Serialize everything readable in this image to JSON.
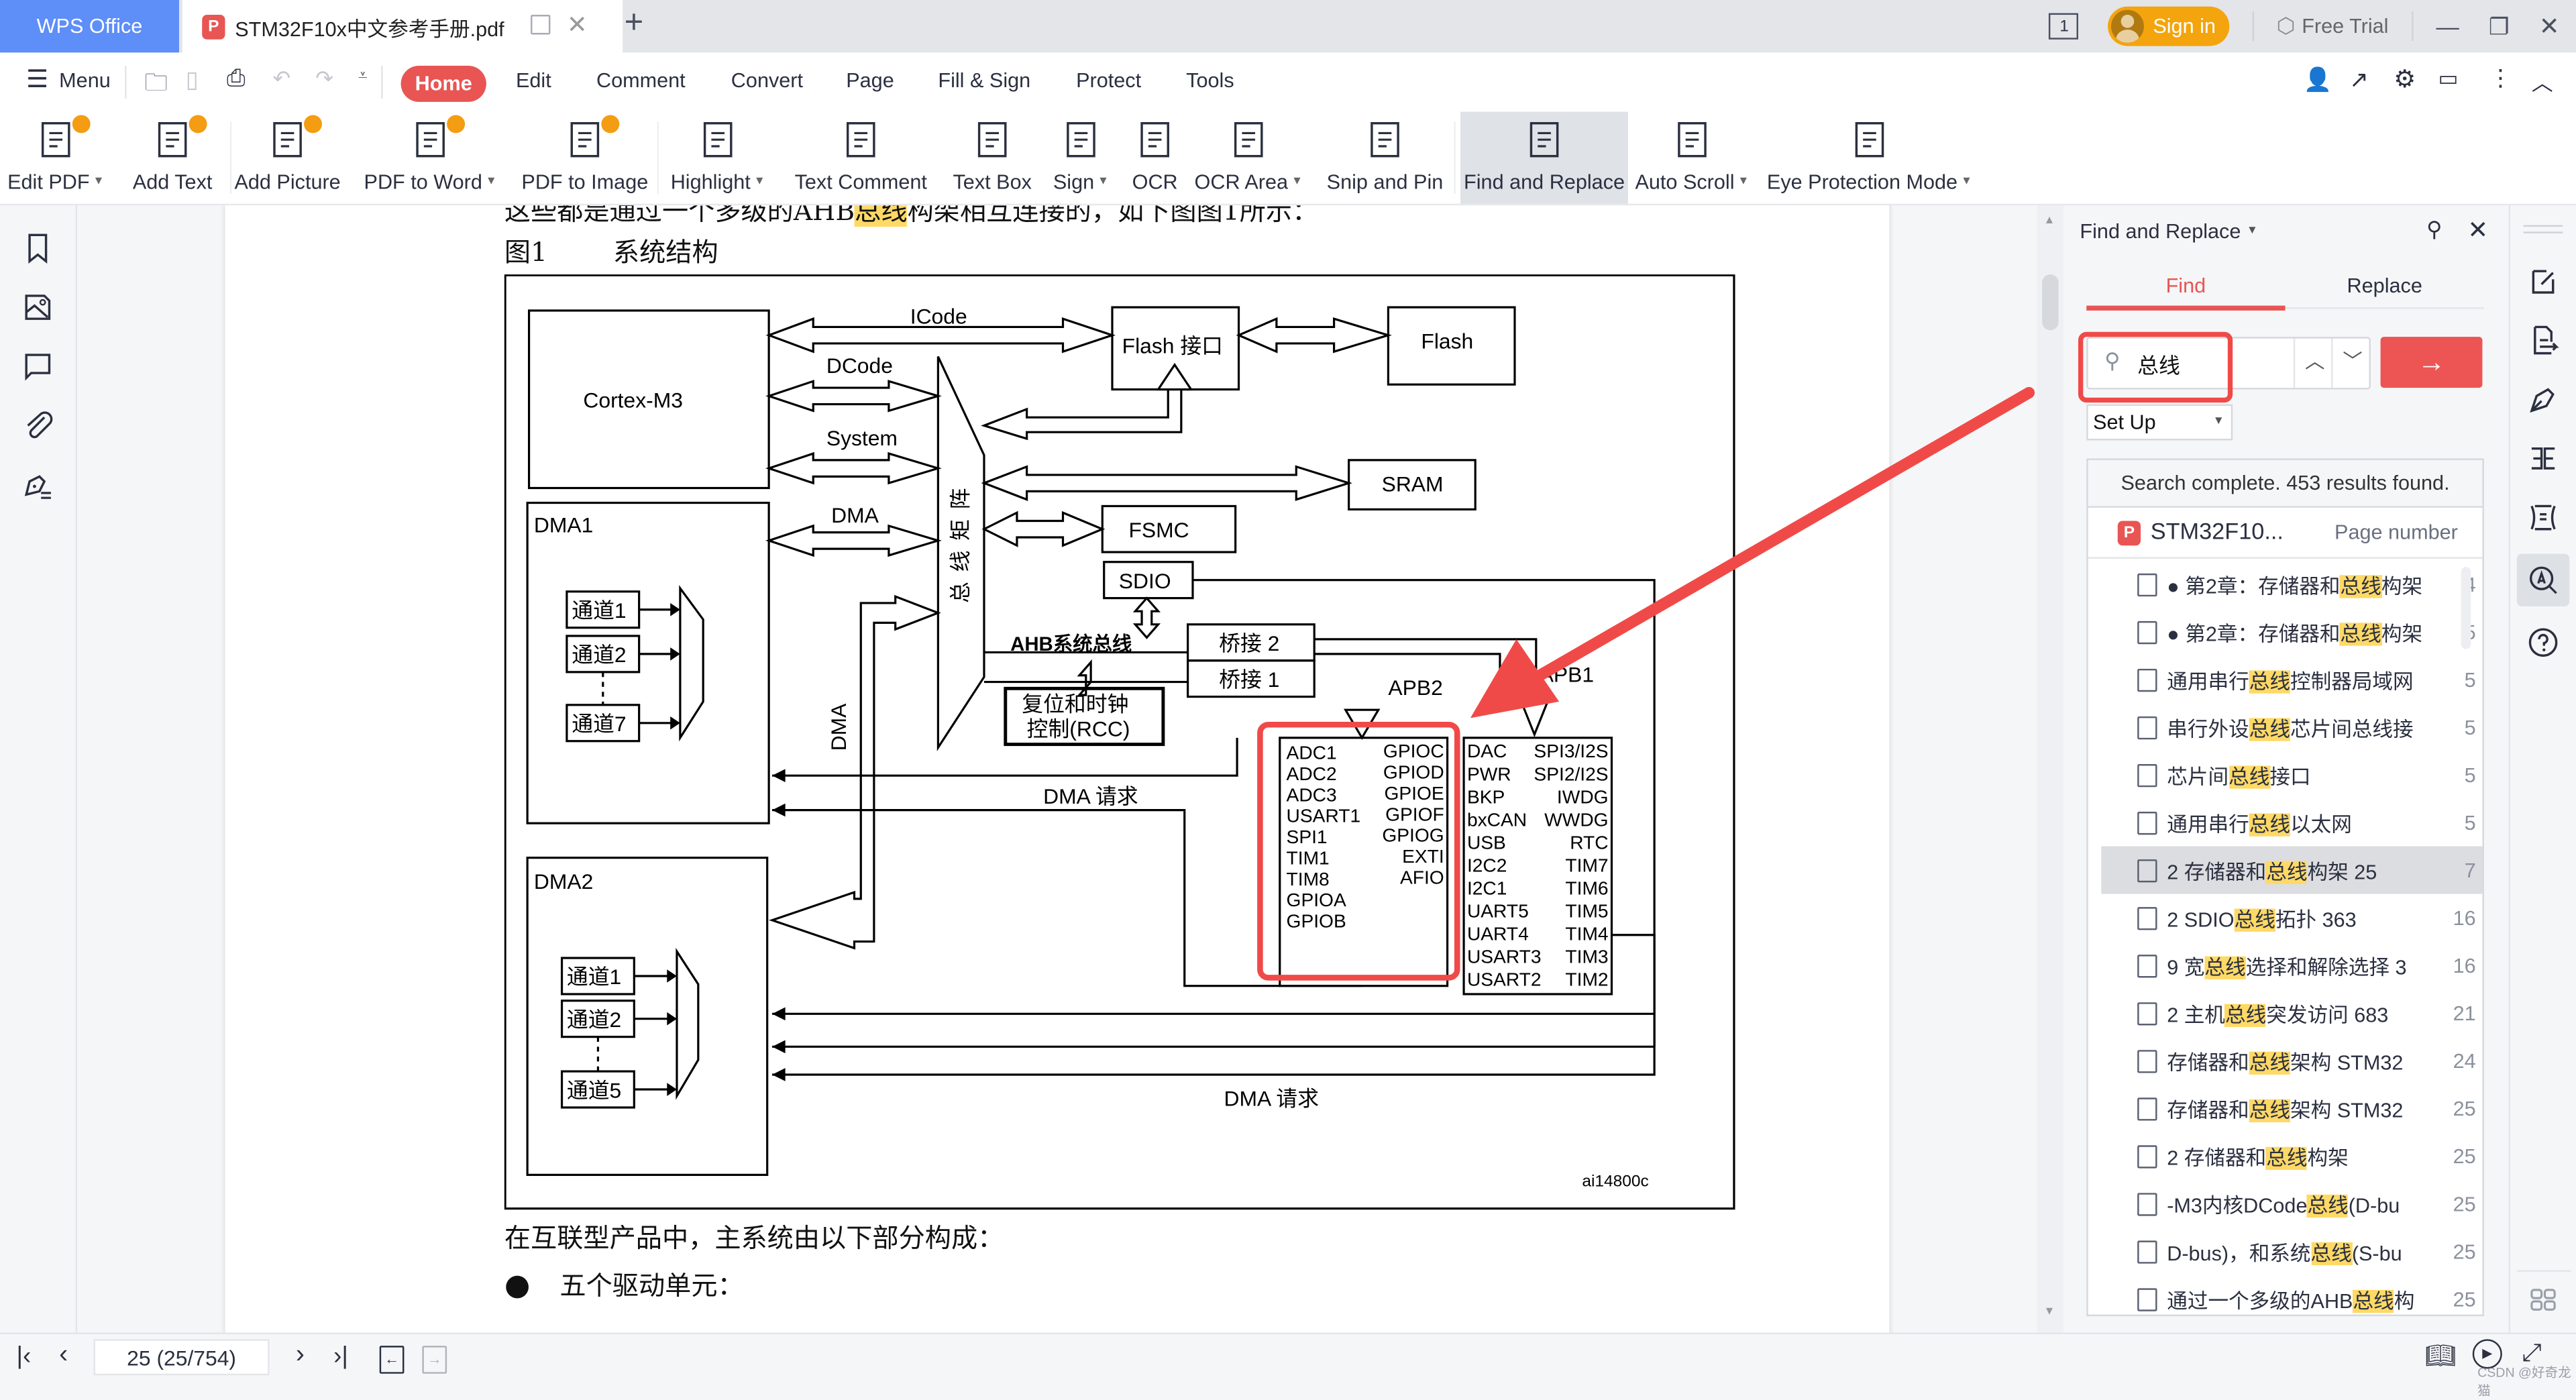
{
  "titlebar": {
    "app_tab": "WPS Office",
    "doc_tab": "STM32F10x中文参考手册.pdf",
    "sign_in": "Sign in",
    "free_trial": "Free Trial",
    "page_count_icon": "1"
  },
  "menubar": {
    "menu": "Menu",
    "tabs": [
      "Home",
      "Edit",
      "Comment",
      "Convert",
      "Page",
      "Fill & Sign",
      "Protect",
      "Tools"
    ],
    "active_tab": "Home"
  },
  "ribbon": {
    "items": [
      {
        "label": "Edit PDF",
        "icon": "edit-pdf-icon",
        "dropdown": true,
        "premium": true
      },
      {
        "label": "Add Text",
        "icon": "add-text-icon",
        "dropdown": false,
        "premium": true
      },
      {
        "label": "Add Picture",
        "icon": "add-picture-icon",
        "dropdown": false,
        "premium": true
      },
      {
        "label": "PDF to Word",
        "icon": "pdf-to-word-icon",
        "dropdown": true,
        "premium": true
      },
      {
        "label": "PDF to Image",
        "icon": "pdf-to-image-icon",
        "dropdown": false,
        "premium": true
      },
      {
        "label": "Highlight",
        "icon": "highlight-icon",
        "dropdown": true,
        "premium": false
      },
      {
        "label": "Text Comment",
        "icon": "text-comment-icon",
        "dropdown": false,
        "premium": false
      },
      {
        "label": "Text Box",
        "icon": "text-box-icon",
        "dropdown": false,
        "premium": false
      },
      {
        "label": "Sign",
        "icon": "sign-icon",
        "dropdown": true,
        "premium": false
      },
      {
        "label": "OCR",
        "icon": "ocr-icon",
        "dropdown": false,
        "premium": false
      },
      {
        "label": "OCR Area",
        "icon": "ocr-area-icon",
        "dropdown": true,
        "premium": false
      },
      {
        "label": "Snip and Pin",
        "icon": "snip-and-pin-icon",
        "dropdown": false,
        "premium": false
      },
      {
        "label": "Find and Replace",
        "icon": "magnifier-icon",
        "dropdown": false,
        "premium": false,
        "active": true
      },
      {
        "label": "Auto Scroll",
        "icon": "auto-scroll-icon",
        "dropdown": true,
        "premium": false
      },
      {
        "label": "Eye Protection Mode",
        "icon": "eye-protection-icon",
        "dropdown": true,
        "premium": false
      }
    ]
  },
  "document": {
    "line_top_before": "这些都是通过一个多级的AHB",
    "line_top_hl": "总线",
    "line_top_after": "构架相互连接的，如下图图1所示：",
    "figure_num": "图1",
    "figure_title": "系统结构",
    "diagram": {
      "cortex": "Cortex-M3",
      "icode": "ICode",
      "dcode": "DCode",
      "system": "System",
      "dma_bus": "DMA",
      "dma_vertical": "DMA",
      "bus_matrix": "总线矩阵",
      "flash_if": "Flash 接口",
      "flash": "Flash",
      "sram": "SRAM",
      "fsmc": "FSMC",
      "sdio": "SDIO",
      "ahb": "AHB系统总线",
      "bridge2": "桥接 2",
      "bridge1": "桥接 1",
      "rcc_line1": "复位和时钟",
      "rcc_line2": "控制(RCC)",
      "apb2": "APB2",
      "apb1": "APB1",
      "dma1": "DMA1",
      "dma2": "DMA2",
      "dma1_channels": [
        "通道1",
        "通道2",
        "通道7"
      ],
      "dma2_channels": [
        "通道1",
        "通道2",
        "通道5"
      ],
      "dma_request_1": "DMA 请求",
      "dma_request_2": "DMA 请求",
      "apb2_left": [
        "ADC1",
        "ADC2",
        "ADC3",
        "USART1",
        "SPI1",
        "TIM1",
        "TIM8",
        "GPIOA",
        "GPIOB"
      ],
      "apb2_right": [
        "GPIOC",
        "GPIOD",
        "GPIOE",
        "GPIOF",
        "GPIOG",
        "EXTI",
        "AFIO"
      ],
      "apb1_left": [
        "DAC",
        "PWR",
        "BKP",
        "bxCAN",
        "USB",
        "I2C2",
        "I2C1",
        "UART5",
        "UART4",
        "USART3",
        "USART2"
      ],
      "apb1_right": [
        "SPI3/I2S",
        "SPI2/I2S",
        "IWDG",
        "WWDG",
        "RTC",
        "TIM7",
        "TIM6",
        "TIM5",
        "TIM4",
        "TIM3",
        "TIM2"
      ],
      "figure_id": "ai14800c"
    },
    "para1": "在互联型产品中，主系统由以下部分构成：",
    "bullet1": "五个驱动单元："
  },
  "annotation": {
    "color": "#f04a48"
  },
  "find_panel": {
    "title": "Find and Replace",
    "tabs": [
      "Find",
      "Replace"
    ],
    "active_tab": "Find",
    "query": "总线",
    "setup": "Set Up",
    "status": "Search complete. 453 results found.",
    "file_name": "STM32F10...",
    "page_header": "Page number",
    "results": [
      {
        "pre": "● 第2章：存储器和",
        "hit": "总线",
        "post": "构架",
        "page": "4"
      },
      {
        "pre": "● 第2章：存储器和",
        "hit": "总线",
        "post": "构架",
        "page": "5"
      },
      {
        "pre": "通用串行",
        "hit": "总线",
        "post": "控制器局域网",
        "page": "5"
      },
      {
        "pre": "串行外设",
        "hit": "总线",
        "post": "芯片间总线接",
        "page": "5"
      },
      {
        "pre": "芯片间",
        "hit": "总线",
        "post": "接口",
        "page": "5"
      },
      {
        "pre": "通用串行",
        "hit": "总线",
        "post": "以太网",
        "page": "5"
      },
      {
        "pre": "2 存储器和",
        "hit": "总线",
        "post": "构架 25",
        "page": "7",
        "selected": true
      },
      {
        "pre": "2 SDIO",
        "hit": "总线",
        "post": "拓扑 363",
        "page": "16"
      },
      {
        "pre": "9 宽",
        "hit": "总线",
        "post": "选择和解除选择 3",
        "page": "16"
      },
      {
        "pre": "2 主机",
        "hit": "总线",
        "post": "突发访问 683",
        "page": "21"
      },
      {
        "pre": "存储器和",
        "hit": "总线",
        "post": "架构 STM32",
        "page": "24"
      },
      {
        "pre": "存储器和",
        "hit": "总线",
        "post": "架构 STM32",
        "page": "25"
      },
      {
        "pre": "2 存储器和",
        "hit": "总线",
        "post": "构架",
        "page": "25"
      },
      {
        "pre": "-M3内核DCode",
        "hit": "总线",
        "post": "(D-bu",
        "page": "25"
      },
      {
        "pre": "D-bus)，和系统",
        "hit": "总线",
        "post": "(S-bu",
        "page": "25"
      },
      {
        "pre": "通过一个多级的AHB",
        "hit": "总线",
        "post": "构",
        "page": "25"
      }
    ]
  },
  "statusbar": {
    "page_field": "25 (25/754)",
    "watermark": "CSDN @好奇龙猫"
  }
}
